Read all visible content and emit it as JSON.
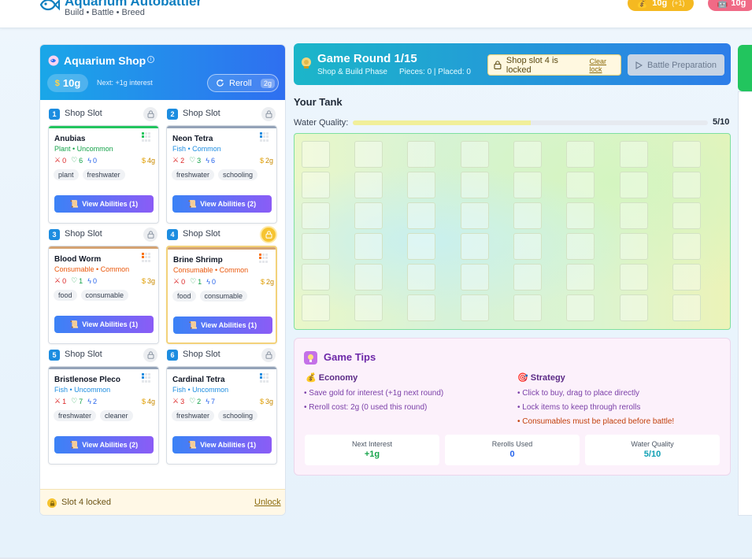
{
  "header": {
    "app_title": "Aquarium Autobattler",
    "app_subtitle": "Build • Battle • Breed",
    "gold_pill": "10g",
    "gold_pill_interest": "(+1)",
    "gold_pill_right": "10g"
  },
  "shop": {
    "title": "Aquarium Shop",
    "gold": "10g",
    "next_interest": "Next: +1g interest",
    "reroll_label": "Reroll",
    "reroll_cost": "2g",
    "slot_label": "Shop Slot",
    "slots": [
      {
        "num": "1",
        "name": "Anubias",
        "type": "Plant • Uncommon",
        "atk": "0",
        "hp": "6",
        "spd": "0",
        "cost": "4g",
        "tags": [
          "plant",
          "freshwater"
        ],
        "abilities": "View Abilities (1)"
      },
      {
        "num": "2",
        "name": "Neon Tetra",
        "type": "Fish • Common",
        "atk": "2",
        "hp": "3",
        "spd": "6",
        "cost": "2g",
        "tags": [
          "freshwater",
          "schooling"
        ],
        "abilities": "View Abilities (2)"
      },
      {
        "num": "3",
        "name": "Blood Worm",
        "type": "Consumable • Common",
        "atk": "0",
        "hp": "1",
        "spd": "0",
        "cost": "3g",
        "tags": [
          "food",
          "consumable"
        ],
        "abilities": "View Abilities (1)"
      },
      {
        "num": "4",
        "name": "Brine Shrimp",
        "type": "Consumable • Common",
        "atk": "0",
        "hp": "1",
        "spd": "0",
        "cost": "2g",
        "tags": [
          "food",
          "consumable"
        ],
        "abilities": "View Abilities (1)"
      },
      {
        "num": "5",
        "name": "Bristlenose Pleco",
        "type": "Fish • Uncommon",
        "atk": "1",
        "hp": "7",
        "spd": "2",
        "cost": "4g",
        "tags": [
          "freshwater",
          "cleaner"
        ],
        "abilities": "View Abilities (2)"
      },
      {
        "num": "6",
        "name": "Cardinal Tetra",
        "type": "Fish • Uncommon",
        "atk": "3",
        "hp": "2",
        "spd": "7",
        "cost": "3g",
        "tags": [
          "freshwater",
          "schooling"
        ],
        "abilities": "View Abilities (1)"
      }
    ],
    "footer_text": "Slot 4 locked",
    "footer_unlock": "Unlock"
  },
  "round": {
    "title": "Game Round 1/15",
    "phase": "Shop & Build Phase",
    "counts": "Pieces: 0 | Placed: 0",
    "lock_notice": "Shop slot 4 is locked",
    "clear_lock": "Clear lock",
    "battle_button": "Battle Preparation"
  },
  "tank": {
    "title": "Your Tank",
    "water_quality_label": "Water Quality:",
    "water_quality_value": "5/10",
    "water_quality_fraction": 0.5,
    "columns": 8,
    "rows": 6
  },
  "tips": {
    "title": "Game Tips",
    "economy_head": "Economy",
    "economy": [
      "• Save gold for interest (+1g next round)",
      "• Reroll cost: 2g (0 used this round)"
    ],
    "strategy_head": "Strategy",
    "strategy": [
      "• Click to buy, drag to place directly",
      "• Lock items to keep through rerolls",
      "• Consumables must be placed before battle!"
    ],
    "stats": [
      {
        "label": "Next Interest",
        "value": "+1g"
      },
      {
        "label": "Rerolls Used",
        "value": "0"
      },
      {
        "label": "Water Quality",
        "value": "5/10"
      }
    ]
  },
  "colors": {
    "primary": "#1d8de0",
    "gold": "#f5b921",
    "stripe_plant": "#22c55e",
    "stripe_fish": "#94a3b8",
    "stripe_consumable": "#d4a373",
    "type_plant": "#16a34a",
    "type_fish": "#1d8de0",
    "type_consumable": "#ea580c",
    "interest_green": "#16a34a",
    "value_blue": "#2563eb",
    "value_teal": "#0e9fb3"
  }
}
